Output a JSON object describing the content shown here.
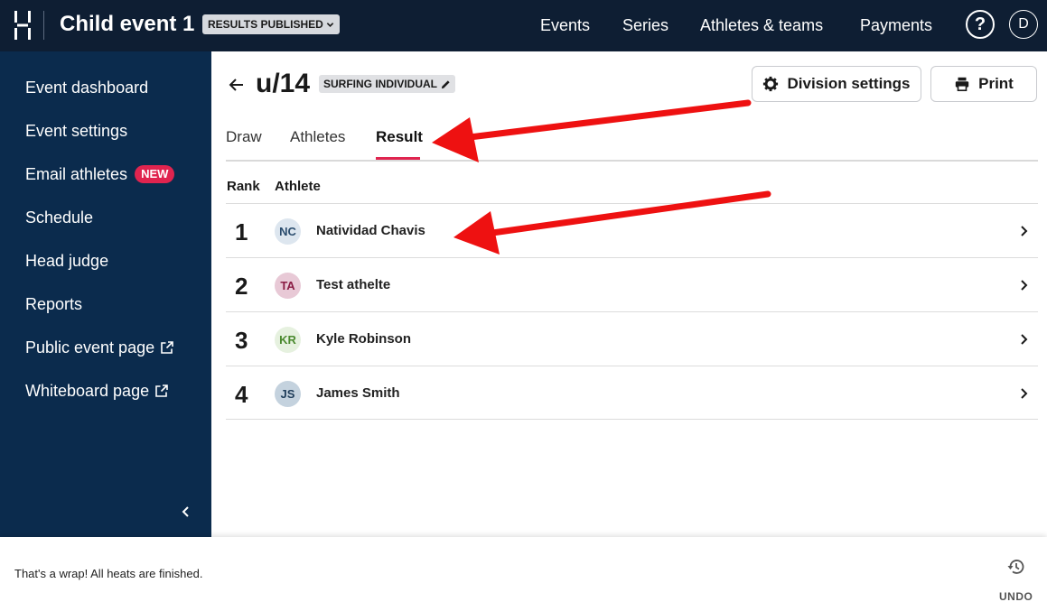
{
  "header": {
    "event_title": "Child event 1",
    "status_pill": "RESULTS PUBLISHED",
    "nav": [
      "Events",
      "Series",
      "Athletes & teams",
      "Payments"
    ],
    "help_label": "?",
    "user_initial": "D"
  },
  "sidebar": {
    "items": [
      {
        "label": "Event dashboard"
      },
      {
        "label": "Event settings"
      },
      {
        "label": "Email athletes",
        "badge": "NEW"
      },
      {
        "label": "Schedule"
      },
      {
        "label": "Head judge"
      },
      {
        "label": "Reports"
      },
      {
        "label": "Public event page",
        "icon": "external-link-icon"
      },
      {
        "label": "Whiteboard page",
        "icon": "external-link-icon"
      }
    ]
  },
  "division": {
    "name": "u/14",
    "type": "SURFING INDIVIDUAL",
    "settings_label": "Division settings",
    "print_label": "Print"
  },
  "tabs": [
    {
      "label": "Draw",
      "active": false
    },
    {
      "label": "Athletes",
      "active": false
    },
    {
      "label": "Result",
      "active": true
    }
  ],
  "results": {
    "columns": [
      "Rank",
      "Athlete"
    ],
    "rows": [
      {
        "rank": "1",
        "initials": "NC",
        "name": "Natividad Chavis",
        "avatar_bg": "#dde6ef",
        "avatar_fg": "#2b4d6e"
      },
      {
        "rank": "2",
        "initials": "TA",
        "name": "Test athelte",
        "avatar_bg": "#e8c9d6",
        "avatar_fg": "#8a1c44"
      },
      {
        "rank": "3",
        "initials": "KR",
        "name": "Kyle Robinson",
        "avatar_bg": "#e6f1df",
        "avatar_fg": "#4b8a2f"
      },
      {
        "rank": "4",
        "initials": "JS",
        "name": "James Smith",
        "avatar_bg": "#c4d2de",
        "avatar_fg": "#1f3d5a"
      }
    ]
  },
  "snackbar": {
    "message": "That's a wrap! All heats are finished.",
    "undo_label": "UNDO"
  },
  "colors": {
    "topbar": "#0e1e33",
    "sidebar": "#0b2b4d",
    "accent": "#e0244f",
    "annotation_arrow": "#ee1111"
  }
}
